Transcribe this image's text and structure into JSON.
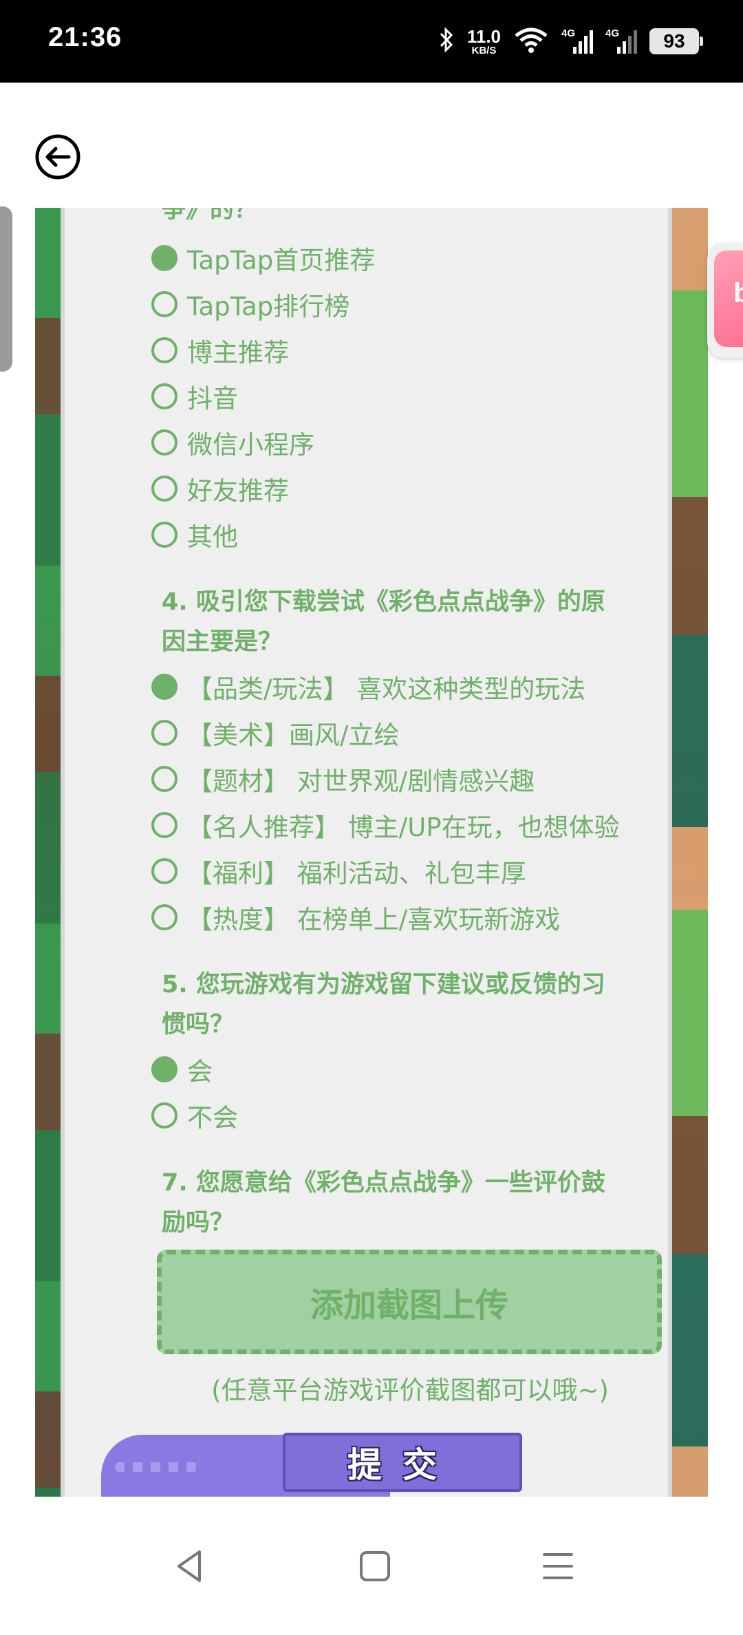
{
  "status_bar": {
    "time": "21:36",
    "net_speed_value": "11.0",
    "net_speed_unit": "KB/S",
    "signal1_label": "4G",
    "signal2_label": "4G",
    "battery": "93",
    "icons": [
      "bluetooth-icon",
      "wifi-icon",
      "signal-icon",
      "signal-icon",
      "battery-icon"
    ]
  },
  "header": {
    "back_icon": "arrow-left-circle-icon"
  },
  "survey": {
    "q3_tail": "争》的？",
    "q3_options": [
      {
        "label": "TapTap首页推荐",
        "selected": true
      },
      {
        "label": "TapTap排行榜",
        "selected": false
      },
      {
        "label": "博主推荐",
        "selected": false
      },
      {
        "label": "抖音",
        "selected": false
      },
      {
        "label": "微信小程序",
        "selected": false
      },
      {
        "label": "好友推荐",
        "selected": false
      },
      {
        "label": "其他",
        "selected": false
      }
    ],
    "q4_line1": "4. 吸引您下载尝试《彩色点点战争》的原",
    "q4_line2": "因主要是？",
    "q4_options": [
      {
        "label": "【品类/玩法】 喜欢这种类型的玩法",
        "selected": true
      },
      {
        "label": "【美术】画风/立绘",
        "selected": false
      },
      {
        "label": "【题材】 对世界观/剧情感兴趣",
        "selected": false
      },
      {
        "label": "【名人推荐】 博主/UP在玩，也想体验",
        "selected": false
      },
      {
        "label": "【福利】 福利活动、礼包丰厚",
        "selected": false
      },
      {
        "label": "【热度】 在榜单上/喜欢玩新游戏",
        "selected": false
      }
    ],
    "q5_line1": "5. 您玩游戏有为游戏留下建议或反馈的习",
    "q5_line2": "惯吗？",
    "q5_options": [
      {
        "label": "会",
        "selected": true
      },
      {
        "label": "不会",
        "selected": false
      }
    ],
    "q7_line1": "7. 您愿意给《彩色点点战争》一些评价鼓",
    "q7_line2": "励吗？",
    "upload_label": "添加截图上传",
    "upload_hint": "(任意平台游戏评价截图都可以哦~)",
    "submit_label": "提交"
  },
  "floating_app": {
    "letter": "b"
  },
  "navbar": {
    "icons": [
      "back-triangle-icon",
      "home-square-icon",
      "menu-lines-icon"
    ]
  },
  "colors": {
    "accent": "#6fb169",
    "upload_fill": "#a1d1a3",
    "submit": "#7f6fd8",
    "panel": "#efefef"
  }
}
